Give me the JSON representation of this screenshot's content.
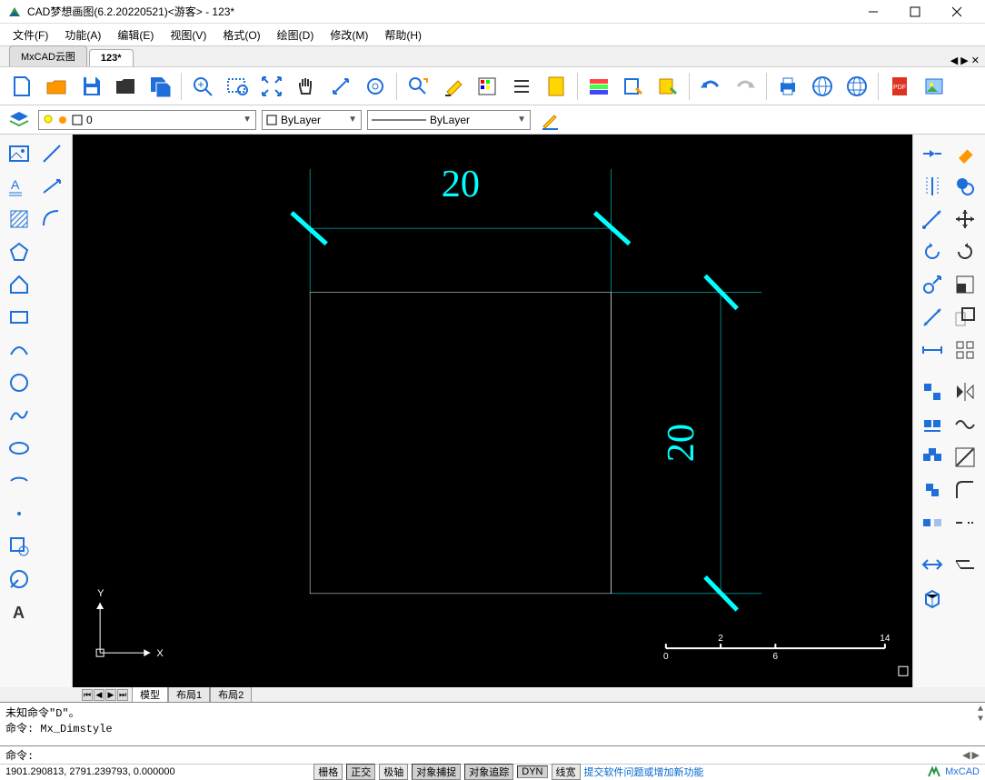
{
  "title": "CAD梦想画图(6.2.20220521)<游客> - 123*",
  "menu": [
    "文件(F)",
    "功能(A)",
    "编辑(E)",
    "视图(V)",
    "格式(O)",
    "绘图(D)",
    "修改(M)",
    "帮助(H)"
  ],
  "tabs": [
    {
      "label": "MxCAD云图",
      "active": false
    },
    {
      "label": "123*",
      "active": true
    }
  ],
  "layer_bar": {
    "layer_name": "0",
    "linetype_label": "ByLayer",
    "lineweight_label": "ByLayer"
  },
  "canvas": {
    "dim_top": "20",
    "dim_right": "20",
    "axis_x": "X",
    "axis_y": "Y",
    "ruler_ticks": [
      "0",
      "2",
      "6",
      "14"
    ]
  },
  "layout_tabs": [
    "模型",
    "布局1",
    "布局2"
  ],
  "console_lines": [
    "未知命令\"D\"。",
    "命令: Mx_Dimstyle"
  ],
  "cmd_prompt": "命令:",
  "status": {
    "coords": "1901.290813, 2791.239793, 0.000000",
    "buttons": [
      "栅格",
      "正交",
      "极轴",
      "对象捕捉",
      "对象追踪",
      "DYN",
      "线宽"
    ],
    "pressed": [
      "正交",
      "对象捕捉",
      "对象追踪",
      "DYN"
    ],
    "link": "提交软件问题或增加新功能",
    "brand": "MxCAD"
  },
  "colors": {
    "cyan": "#00ffff",
    "blue_icon": "#1e6fd9",
    "orange": "#ff9800"
  }
}
